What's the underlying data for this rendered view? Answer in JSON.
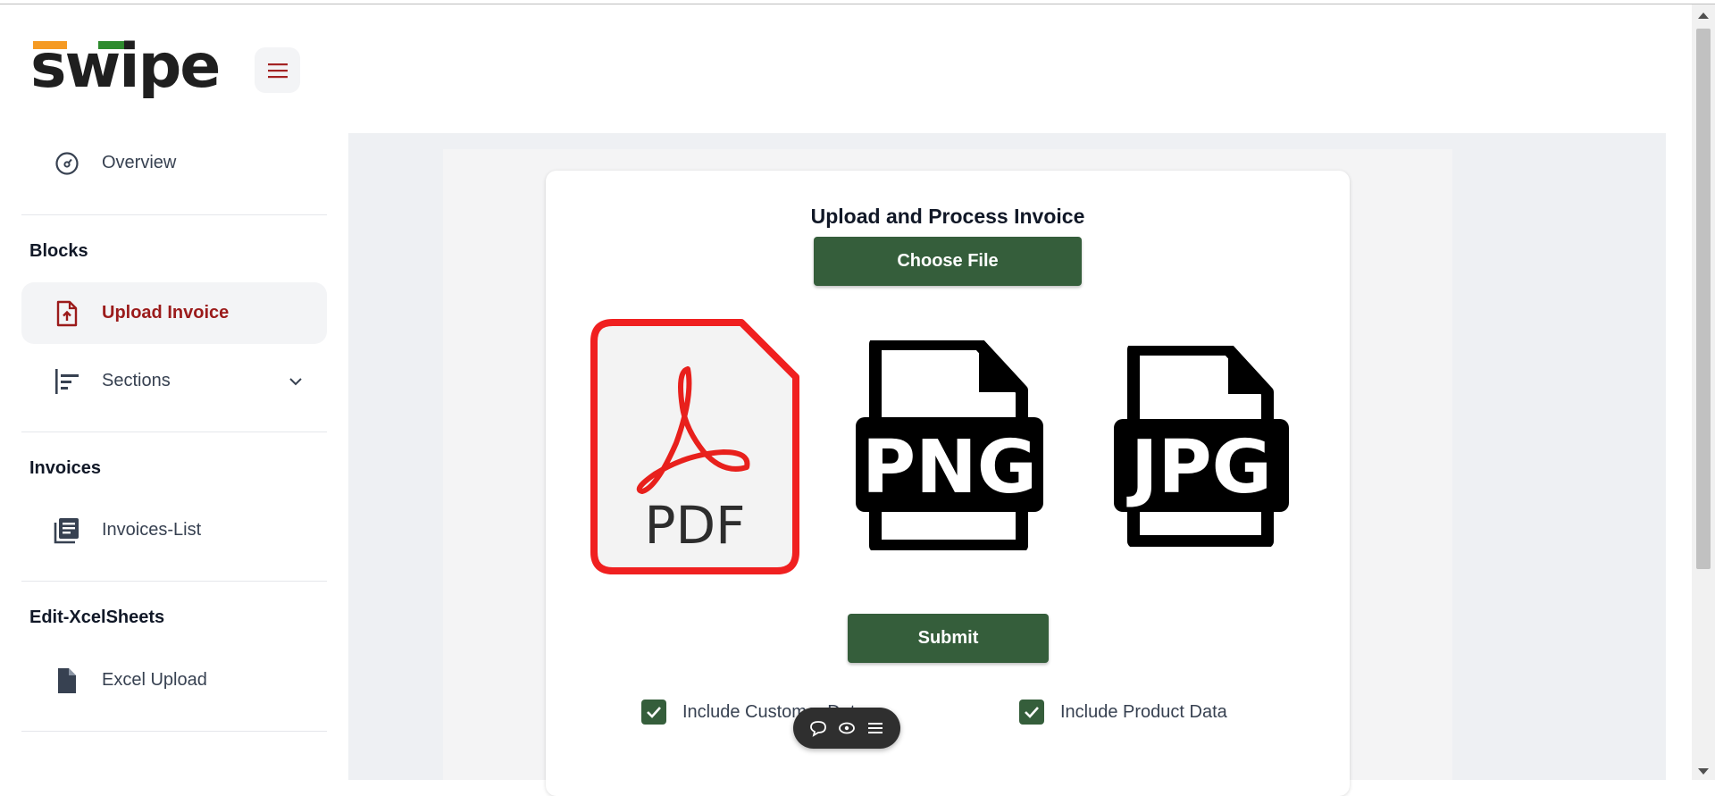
{
  "brand": {
    "logo_text": "swipe",
    "colors": {
      "orange": "#f59a23",
      "green": "#2e8b2e",
      "dark": "#1f1f1f"
    }
  },
  "header": {
    "menu_icon": "hamburger-icon"
  },
  "sidebar": {
    "overview": {
      "label": "Overview",
      "icon": "gauge-icon"
    },
    "sections": [
      {
        "title": "Blocks"
      },
      {
        "title": "Invoices"
      },
      {
        "title": "Edit-XcelSheets"
      }
    ],
    "items": [
      {
        "label": "Upload Invoice",
        "icon": "file-upload-icon",
        "active": true
      },
      {
        "label": "Sections",
        "icon": "align-left-icon",
        "expandable": true
      },
      {
        "label": "Invoices-List",
        "icon": "list-document-icon"
      },
      {
        "label": "Excel Upload",
        "icon": "file-icon"
      }
    ]
  },
  "upload": {
    "title": "Upload and Process Invoice",
    "choose_file_label": "Choose File",
    "submit_label": "Submit",
    "file_types": [
      {
        "label": "PDF",
        "icon": "pdf-file-icon",
        "selected": true
      },
      {
        "label": "PNG",
        "icon": "png-file-icon",
        "selected": false
      },
      {
        "label": "JPG",
        "icon": "jpg-file-icon",
        "selected": false
      }
    ],
    "checkboxes": [
      {
        "label": "Include Customer Data",
        "checked": true
      },
      {
        "label": "Include Product Data",
        "checked": true
      }
    ],
    "accent_color": "#355e3b",
    "selected_border_color": "#f02020"
  },
  "floating_toolbar": {
    "icons": [
      "comment-icon",
      "eye-icon",
      "menu-icon"
    ]
  }
}
